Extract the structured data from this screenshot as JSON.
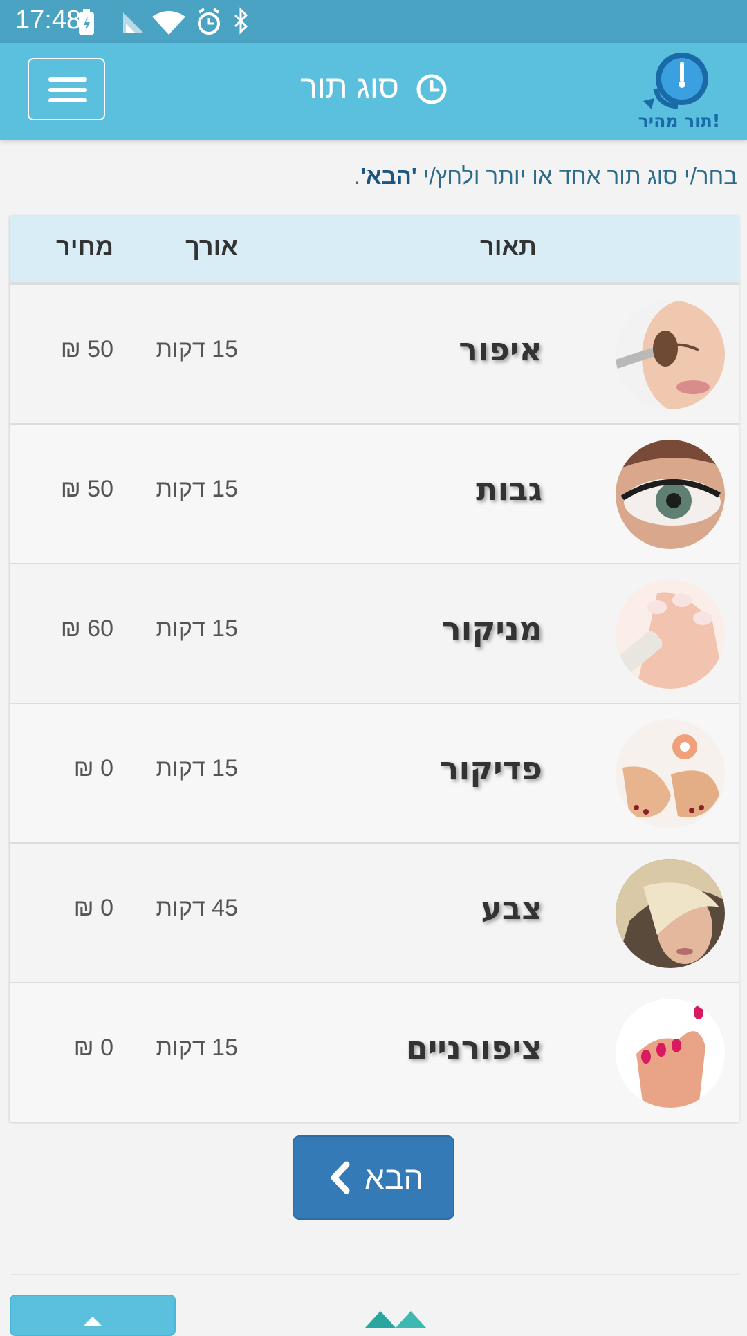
{
  "status_bar": {
    "time": "17:48"
  },
  "header": {
    "title": "סוג תור",
    "logo_text": "תור מהיר!"
  },
  "instructions": {
    "text": "בחר/י סוג תור אחד או יותר ולחץ/י ",
    "highlight": "'הבא'",
    "suffix": "."
  },
  "table": {
    "columns": {
      "description": "תאור",
      "length": "אורך",
      "price": "מחיר"
    },
    "rows": [
      {
        "name": "איפור",
        "length": "15 דקות",
        "price": "50 ₪",
        "image": "makeup-brush-face"
      },
      {
        "name": "גבות",
        "length": "15 דקות",
        "price": "50 ₪",
        "image": "eye-closeup"
      },
      {
        "name": "מניקור",
        "length": "15 דקות",
        "price": "60 ₪",
        "image": "manicure-hand"
      },
      {
        "name": "פדיקור",
        "length": "15 דקות",
        "price": "0 ₪",
        "image": "pedicure-feet"
      },
      {
        "name": "צבע",
        "length": "45 דקות",
        "price": "0 ₪",
        "image": "hair-color-woman"
      },
      {
        "name": "ציפורניים",
        "length": "15 דקות",
        "price": "0 ₪",
        "image": "painted-nails-hand"
      }
    ]
  },
  "next_button": {
    "label": "הבא"
  },
  "colors": {
    "status_bar": "#4aa3c2",
    "navbar": "#5bc0de",
    "table_header": "#d9edf7",
    "primary_button": "#337ab7"
  }
}
